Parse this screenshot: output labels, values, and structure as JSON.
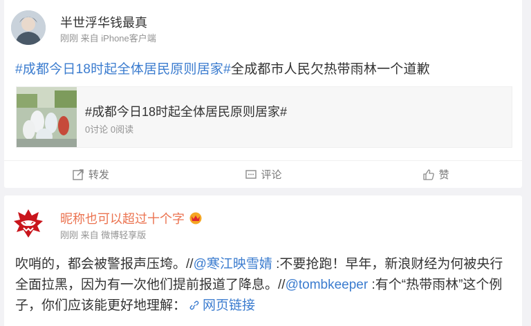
{
  "post1": {
    "author": "半世浮华钱最真",
    "time": "刚刚",
    "from_label": "来自",
    "source": "iPhone客户端",
    "topic_tag": "#成都今日18时起全体居民原则居家#",
    "text": "全成都市人民欠热带雨林一个道歉",
    "topic_card": {
      "title": "#成都今日18时起全体居民原则居家#",
      "stats": "0讨论 0阅读"
    },
    "actions": {
      "repost": "转发",
      "comment": "评论",
      "like": "赞"
    }
  },
  "post2": {
    "author": "昵称也可以超过十个字",
    "time": "刚刚",
    "from_label": "来自",
    "source": "微博轻享版",
    "text_part1": "吹哨的，都会被警报声压垮。//",
    "mention1": "@寒江映雪婧",
    "text_part2": " :不要抢跑！早年，新浪财经为何被央行全面拉黑，因为有一次他们提前报道了降息。//",
    "mention2": "@tombkeeper",
    "text_part3": " :有个“热带雨林”这个例子，你们应该能更好地理解：",
    "link_label": "网页链接"
  },
  "colors": {
    "link": "#eb7350",
    "topic": "#3b7ccf",
    "text": "#333333",
    "meta": "#939393"
  }
}
